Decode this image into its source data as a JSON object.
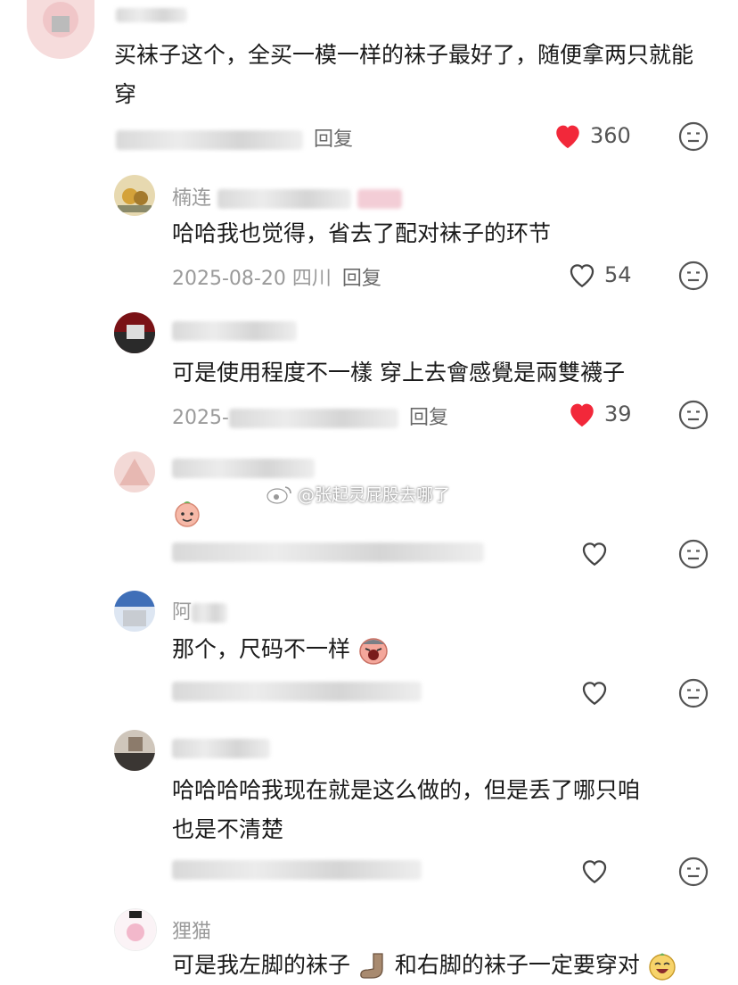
{
  "watermark": {
    "text": "@张起灵屁股去哪了"
  },
  "comments": [
    {
      "text": "买袜子这个，全买一模一样的袜子最好了，随便拿两只就能穿",
      "reply": "回复",
      "likes": "360",
      "liked": true
    },
    {
      "username": "楠连",
      "text": "哈哈我也觉得，省去了配对袜子的环节",
      "meta": "2025-08-20 四川",
      "reply": "回复",
      "likes": "54",
      "liked": false
    },
    {
      "text": "可是使用程度不一樣 穿上去會感覺是兩雙襪子",
      "meta_prefix": "2025-",
      "reply": "回复",
      "likes": "39",
      "liked": true
    },
    {
      "liked": false
    },
    {
      "username": "阿",
      "text": "那个，尺码不一样",
      "liked": false
    },
    {
      "text_line1": "哈哈哈哈我现在就是这么做的，但是丢了哪只咱",
      "text_line2": "也是不清楚",
      "liked": false
    },
    {
      "username": "狸猫",
      "text_part1": "可是我左脚的袜子",
      "text_part2": "和右脚的袜子一定要穿对"
    }
  ],
  "colors": {
    "heart_red": "#f2283a",
    "meta_grey": "#9a9a9a",
    "text_dark": "#1a1a1a"
  },
  "icons": [
    "heart-icon",
    "dislike-face-icon",
    "weibo-logo-icon",
    "sock-icon"
  ]
}
